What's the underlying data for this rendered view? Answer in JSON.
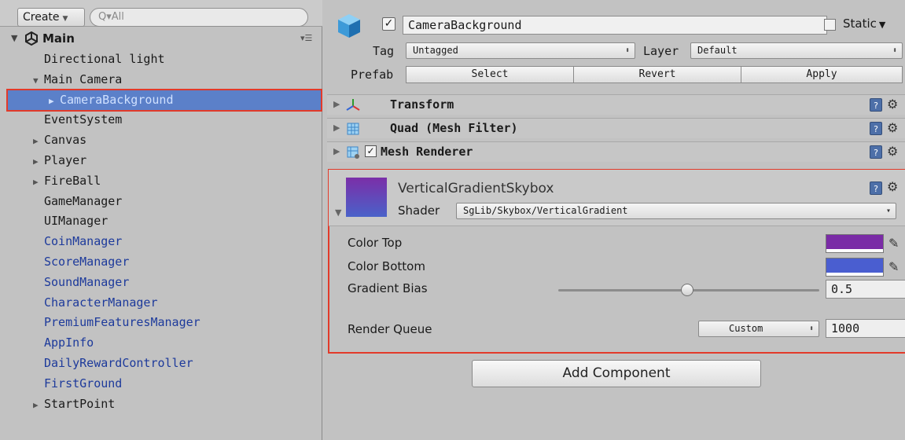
{
  "hierarchy": {
    "create_label": "Create",
    "search_placeholder": "Q▾All",
    "scene_name": "Main",
    "items": [
      {
        "label": "Directional light",
        "indent": 0,
        "fold": "",
        "color": "normal"
      },
      {
        "label": "Main Camera",
        "indent": 0,
        "fold": "▼",
        "color": "normal"
      },
      {
        "label": "CameraBackground",
        "indent": 1,
        "fold": "▶",
        "color": "selected"
      },
      {
        "label": "EventSystem",
        "indent": 0,
        "fold": "",
        "color": "normal"
      },
      {
        "label": "Canvas",
        "indent": 0,
        "fold": "▶",
        "color": "normal"
      },
      {
        "label": "Player",
        "indent": 0,
        "fold": "▶",
        "color": "normal"
      },
      {
        "label": "FireBall",
        "indent": 0,
        "fold": "▶",
        "color": "normal"
      },
      {
        "label": "GameManager",
        "indent": 0,
        "fold": "",
        "color": "normal"
      },
      {
        "label": "UIManager",
        "indent": 0,
        "fold": "",
        "color": "normal"
      },
      {
        "label": "CoinManager",
        "indent": 0,
        "fold": "",
        "color": "blue"
      },
      {
        "label": "ScoreManager",
        "indent": 0,
        "fold": "",
        "color": "blue"
      },
      {
        "label": "SoundManager",
        "indent": 0,
        "fold": "",
        "color": "blue"
      },
      {
        "label": "CharacterManager",
        "indent": 0,
        "fold": "",
        "color": "blue"
      },
      {
        "label": "PremiumFeaturesManager",
        "indent": 0,
        "fold": "",
        "color": "blue"
      },
      {
        "label": "AppInfo",
        "indent": 0,
        "fold": "",
        "color": "blue"
      },
      {
        "label": "DailyRewardController",
        "indent": 0,
        "fold": "",
        "color": "blue"
      },
      {
        "label": "FirstGround",
        "indent": 0,
        "fold": "",
        "color": "blue"
      },
      {
        "label": "StartPoint",
        "indent": 0,
        "fold": "▶",
        "color": "normal"
      }
    ]
  },
  "inspector": {
    "object_name": "CameraBackground",
    "static_label": "Static",
    "tag_label": "Tag",
    "tag_value": "Untagged",
    "layer_label": "Layer",
    "layer_value": "Default",
    "prefab_label": "Prefab",
    "prefab_buttons": [
      "Select",
      "Revert",
      "Apply"
    ],
    "components": [
      {
        "name": "Transform",
        "icon": "transform-icon"
      },
      {
        "name": "Quad (Mesh Filter)",
        "icon": "mesh-filter-icon"
      },
      {
        "name": "Mesh Renderer",
        "icon": "mesh-renderer-icon"
      }
    ],
    "material": {
      "name": "VerticalGradientSkybox",
      "shader_label": "Shader",
      "shader_value": "SgLib/Skybox/VerticalGradient",
      "color_top_label": "Color Top",
      "color_top": "#7a2ba6",
      "color_bottom_label": "Color Bottom",
      "color_bottom": "#4a5ed0",
      "gradient_bias_label": "Gradient Bias",
      "gradient_bias_value": "0.5",
      "render_queue_label": "Render Queue",
      "render_queue_mode": "Custom",
      "render_queue_value": "1000"
    },
    "add_component_label": "Add Component"
  },
  "colors": {
    "highlight": "#e23a2a",
    "selection": "#5b80c9",
    "prefab_blue": "#1d3a9b"
  }
}
